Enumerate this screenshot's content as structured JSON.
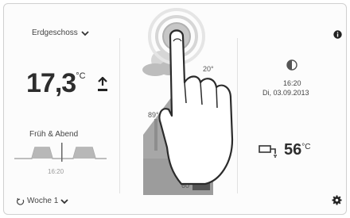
{
  "header": {
    "floor_select": "Erdgeschoss"
  },
  "room": {
    "temp_int": "17,3",
    "temp_unit": "°C",
    "program_name": "Früh & Abend",
    "program_time": "16:20",
    "schedule_select": "Woche 1"
  },
  "center": {
    "label_roof": "20°",
    "label_left": "89°",
    "label_bottom": "60°"
  },
  "status": {
    "time": "16:20",
    "date": "Di, 03.09.2013"
  },
  "dhw": {
    "temp": "56",
    "unit": "°C"
  },
  "colors": {
    "accent_gray": "#8a8a8a",
    "house_fill": "#a7a7a7",
    "tank_dark": "#555555",
    "text_dark": "#2d2d2d"
  }
}
